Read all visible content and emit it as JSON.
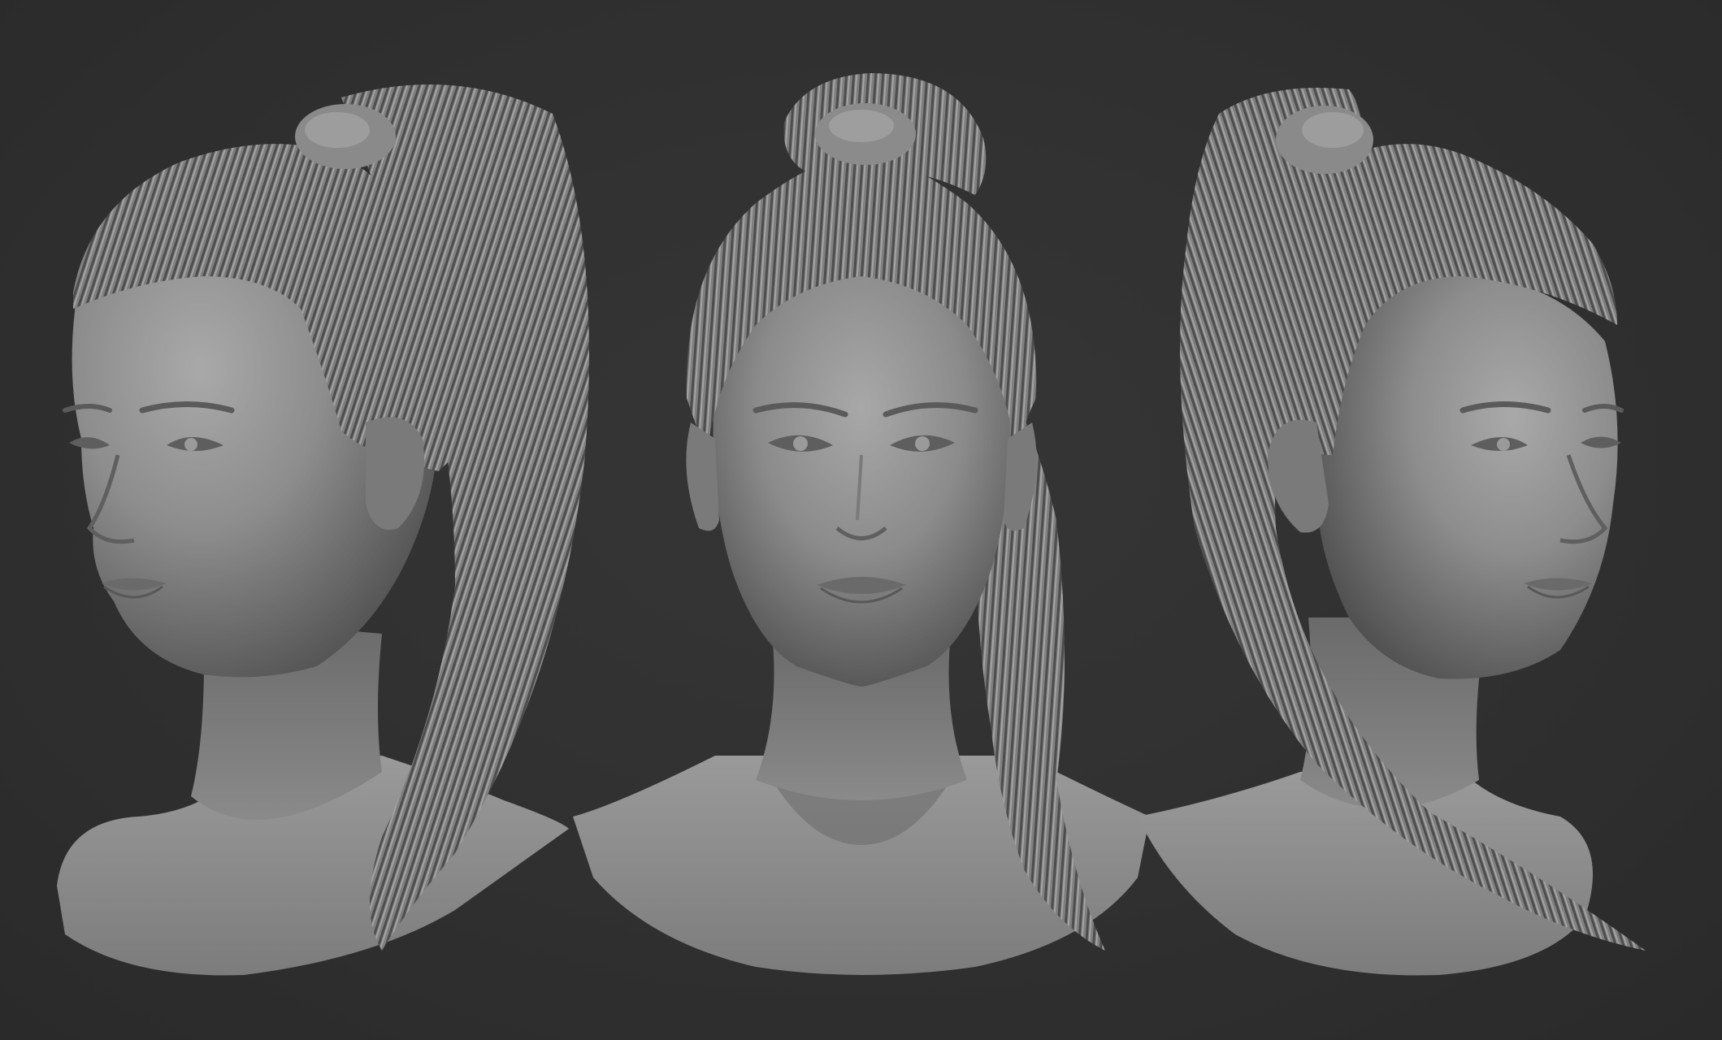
{
  "scene": {
    "background_color": "#2f2f2f",
    "material_color": "#8a8a8a",
    "views": [
      {
        "id": "three-quarter-left",
        "hair": "high-ponytail"
      },
      {
        "id": "front",
        "hair": "high-ponytail"
      },
      {
        "id": "three-quarter-right",
        "hair": "high-ponytail"
      }
    ]
  }
}
